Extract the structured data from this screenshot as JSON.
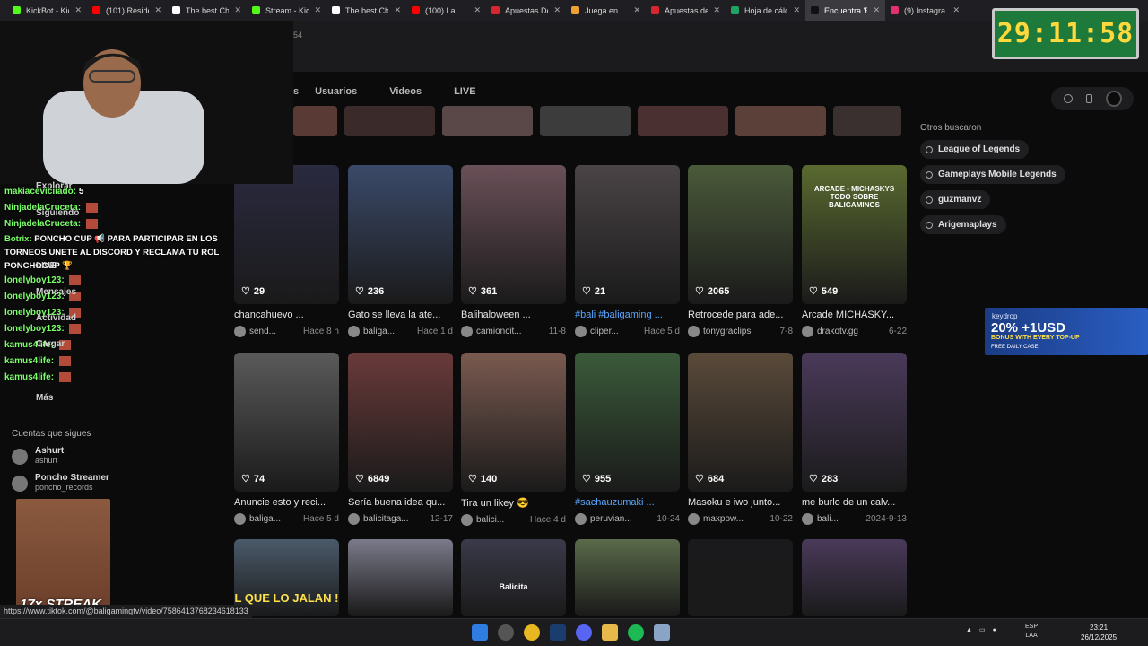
{
  "browser": {
    "tabs": [
      {
        "label": "KickBot - Kic",
        "color": "#53fc18",
        "active": false
      },
      {
        "label": "(101) Reside",
        "color": "#ff0000",
        "active": false
      },
      {
        "label": "The best Ch",
        "color": "#ffffff",
        "active": false
      },
      {
        "label": "Stream - Kic",
        "color": "#53fc18",
        "active": false
      },
      {
        "label": "The best Ch",
        "color": "#ffffff",
        "active": false
      },
      {
        "label": "(100) La",
        "color": "#ff0000",
        "active": false
      },
      {
        "label": "Apuestas De",
        "color": "#d9262c",
        "active": false
      },
      {
        "label": "Juega en",
        "color": "#f0a030",
        "active": false
      },
      {
        "label": "Apuestas de",
        "color": "#d9262c",
        "active": false
      },
      {
        "label": "Hoja de cálc",
        "color": "#1fa463",
        "active": false
      },
      {
        "label": "Encuentra 'E",
        "color": "#111111",
        "active": true
      },
      {
        "label": "(9) Instagra",
        "color": "#e1306c",
        "active": false
      }
    ],
    "url_fragment": "54",
    "status_url": "https://www.tiktok.com/@baligamingtv/video/7586413768234618133"
  },
  "timer": "29:11:58",
  "nav": {
    "tabs": [
      "Usuarios",
      "Videos",
      "LIVE"
    ],
    "first_tab_partial": "s"
  },
  "related": {
    "heading": "Otros buscaron",
    "items": [
      "League of Legends",
      "Gameplays Mobile Legends",
      "guzmanvz",
      "Arigemaplays"
    ]
  },
  "ad": {
    "brand": "keydrop",
    "headline": "20% +1USD",
    "sub": "BONUS WITH EVERY TOP-UP",
    "cta": "FREE DAILY CASE"
  },
  "videos": [
    {
      "likes": "29",
      "title": "chancahuevo ...",
      "user": "send...",
      "date": "Hace 8 h",
      "tag": false,
      "color": "#2a2a40"
    },
    {
      "likes": "236",
      "title": "Gato se lleva la ate...",
      "user": "baliga...",
      "date": "Hace 1 d",
      "tag": false,
      "color": "#3b4a6a"
    },
    {
      "likes": "361",
      "title": "Balihaloween ...",
      "user": "camioncit...",
      "date": "11-8",
      "tag": false,
      "color": "#6a5058"
    },
    {
      "likes": "21",
      "title": "#bali #baligaming ...",
      "user": "cliper...",
      "date": "Hace 5 d",
      "tag": true,
      "color": "#4a4446"
    },
    {
      "likes": "2065",
      "title": "Retrocede para ade...",
      "user": "tonygraclips",
      "date": "7-8",
      "tag": false,
      "color": "#4b5a3a"
    },
    {
      "likes": "549",
      "title": "Arcade MICHASKY...",
      "user": "drakotv.gg",
      "date": "6-22",
      "tag": false,
      "color": "#5a6a30"
    },
    {
      "likes": "74",
      "title": "Anuncie esto y reci...",
      "user": "baliga...",
      "date": "Hace 5 d",
      "tag": false,
      "color": "#5a5a5a"
    },
    {
      "likes": "6849",
      "title": "Sería buena idea qu...",
      "user": "balicitaga...",
      "date": "12-17",
      "tag": false,
      "color": "#6a3a3a"
    },
    {
      "likes": "140",
      "title": "Tira un likey 😎",
      "user": "balici...",
      "date": "Hace 4 d",
      "tag": false,
      "color": "#7a5a50"
    },
    {
      "likes": "955",
      "title": "#sachauzumaki ...",
      "user": "peruvian...",
      "date": "10-24",
      "tag": true,
      "color": "#3a5a3a"
    },
    {
      "likes": "684",
      "title": "Masoku e iwo junto...",
      "user": "maxpow...",
      "date": "10-22",
      "tag": false,
      "color": "#5a4a3a"
    },
    {
      "likes": "283",
      "title": "me burlo de un calv...",
      "user": "bali...",
      "date": "2024-9-13",
      "tag": false,
      "color": "#4a3a5a"
    },
    {
      "likes": "",
      "title": "",
      "user": "",
      "date": "",
      "tag": false,
      "color": "#4a5a6a"
    },
    {
      "likes": "",
      "title": "",
      "user": "",
      "date": "",
      "tag": false,
      "color": "#7a7a8a"
    },
    {
      "likes": "",
      "title": "",
      "user": "",
      "date": "",
      "tag": false,
      "color": "#3a3a4a"
    },
    {
      "likes": "",
      "title": "",
      "user": "",
      "date": "",
      "tag": false,
      "color": "#5a6a4a"
    },
    {
      "likes": "",
      "title": "",
      "user": "",
      "date": "",
      "tag": false,
      "color": "#1a1a1c"
    },
    {
      "likes": "",
      "title": "",
      "user": "",
      "date": "",
      "tag": false,
      "color": "#4a3a5a"
    }
  ],
  "thumb_overlay_text": {
    "arcade": "ARCADE - MICHASKYS TODO SOBRE BALIGAMINGS",
    "que_lo_jalan": "L QUE LO JALAN !",
    "balicita": "Balicita"
  },
  "stream": {
    "chat": [
      {
        "user": "makiaceviciiado:",
        "msg": "5"
      },
      {
        "user": "NinjadelaCruceta:",
        "msg": ""
      },
      {
        "user": "NinjadelaCruceta:",
        "msg": ""
      },
      {
        "user": "Botrix:",
        "msg": "PONCHO CUP 📢 PARA PARTICIPAR EN LOS TORNEOS UNETE AL DISCORD Y RECLAMA TU ROL PONCHOCUP 🏆"
      },
      {
        "user": "lonelyboy123:",
        "msg": ""
      },
      {
        "user": "lonelyboy123:",
        "msg": ""
      },
      {
        "user": "lonelyboy123:",
        "msg": ""
      },
      {
        "user": "lonelyboy123:",
        "msg": ""
      },
      {
        "user": "kamus4life:",
        "msg": ""
      },
      {
        "user": "kamus4life:",
        "msg": ""
      },
      {
        "user": "kamus4life:",
        "msg": ""
      }
    ],
    "sidebar_ghosts": {
      "explorar": "Explorar",
      "siguiendo": "Siguiendo",
      "mensajes": "Mensajes",
      "actividad": "Actividad",
      "cargar": "Cargar",
      "mas": "Más",
      "live": "LIVE"
    },
    "following_heading": "Cuentas que sigues",
    "accounts": [
      {
        "name": "Ashurt",
        "handle": "ashurt"
      },
      {
        "name": "Poncho Streamer",
        "handle": "poncho_records"
      }
    ],
    "streak": "17x STREAK"
  },
  "taskbar": {
    "lang_top": "ESP",
    "lang_bottom": "LAA",
    "time": "23:21",
    "date": "26/12/2025"
  }
}
